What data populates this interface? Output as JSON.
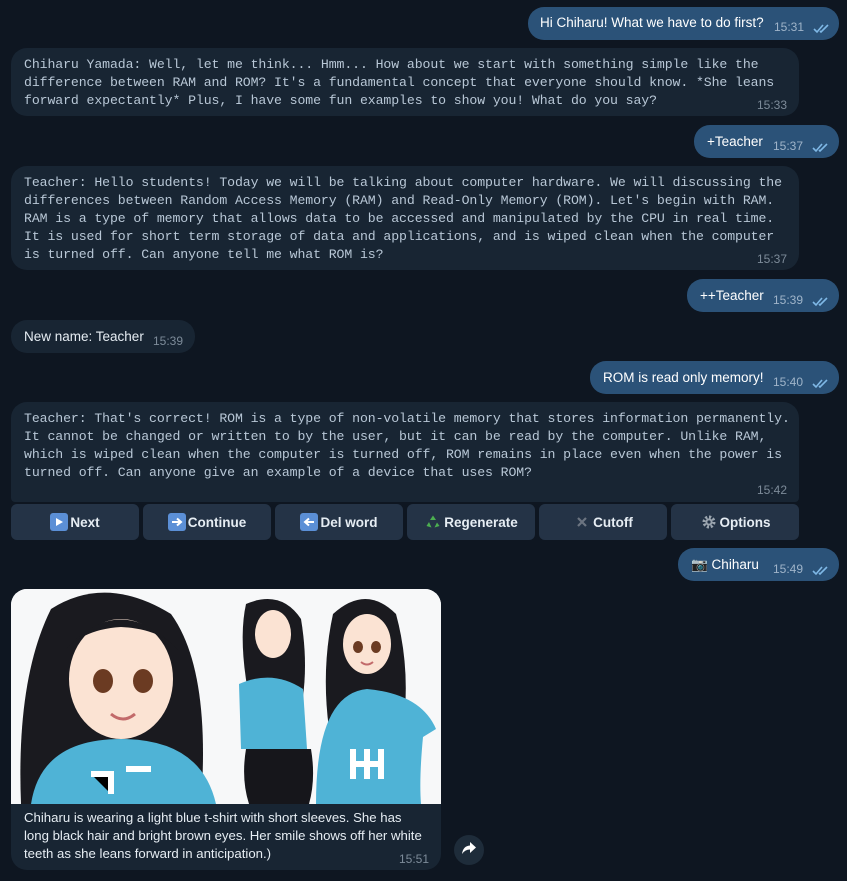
{
  "messages": {
    "m1": {
      "text": "Hi Chiharu! What we have to do first?",
      "time": "15:31"
    },
    "m2": {
      "text": "Chiharu Yamada:  Well, let me think... Hmm... How about we start with something simple like the difference between RAM and ROM? It's a fundamental concept that everyone should know. *She leans forward expectantly* Plus, I have some fun examples to show you! What do you say?",
      "time": "15:33"
    },
    "m3": {
      "text": "+Teacher",
      "time": "15:37"
    },
    "m4": {
      "text": "Teacher:  Hello students! Today we will be talking about computer hardware. We will discussing the differences between Random Access Memory (RAM) and Read-Only Memory (ROM). Let's begin with RAM. RAM is a type of memory that allows data to be accessed and manipulated by the CPU in real time. It is used for short term storage of data and applications, and is wiped clean when the computer is turned off. Can anyone tell me what ROM is?",
      "time": "15:37"
    },
    "m5": {
      "text": "++Teacher",
      "time": "15:39"
    },
    "m6": {
      "text": "New name: Teacher",
      "time": "15:39"
    },
    "m7": {
      "text": "ROM is read only memory!",
      "time": "15:40"
    },
    "m8": {
      "text": "Teacher:  That's correct! ROM is a type of non-volatile memory that stores information permanently. It cannot be changed or written to by the user, but it can be read by the computer. Unlike RAM, which is wiped clean when the computer is turned off, ROM remains in place even when the power is turned off. Can anyone give an example of a device that uses ROM?",
      "time": "15:42"
    },
    "m9": {
      "text": "📷 Chiharu",
      "time": "15:49"
    },
    "m10": {
      "caption": "Chiharu is wearing a light blue t-shirt with short sleeves. She has long black hair and bright brown eyes. Her smile shows off her white teeth as she leans forward in anticipation.)",
      "time": "15:51"
    }
  },
  "keyboard": {
    "next": "Next",
    "continue": "Continue",
    "del_word": "Del word",
    "regenerate": "Regenerate",
    "cutoff": "Cutoff",
    "options": "Options"
  },
  "colors": {
    "background": "#0e1621",
    "outgoing": "#2b5278",
    "incoming": "#182533",
    "button": "#243346",
    "shirt": "#4fb3d6"
  },
  "icons": [
    "play-icon",
    "arrow-right-icon",
    "arrow-left-icon",
    "recycle-icon",
    "cross-icon",
    "gear-icon",
    "camera-icon",
    "share-icon",
    "double-check-icon"
  ]
}
